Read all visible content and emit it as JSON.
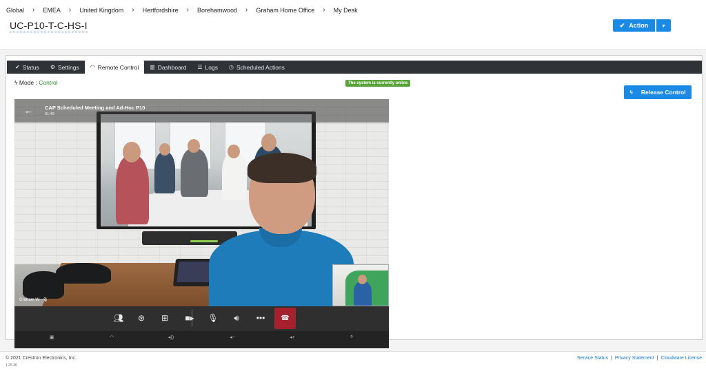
{
  "breadcrumb": [
    "Global",
    "EMEA",
    "United Kingdom",
    "Hertfordshire",
    "Borehamwood",
    "Graham Home Office",
    "My Desk"
  ],
  "page": {
    "title": "UC-P10-T-C-HS-I"
  },
  "action": {
    "label": "Action",
    "dropdown_icon": "caret-down-icon"
  },
  "tabs": [
    {
      "label": "Status",
      "icon": "check-icon"
    },
    {
      "label": "Settings",
      "icon": "gear-icon"
    },
    {
      "label": "Remote Control",
      "icon": "wifi-icon",
      "active": true
    },
    {
      "label": "Dashboard",
      "icon": "bar-chart-icon"
    },
    {
      "label": "Logs",
      "icon": "list-icon"
    },
    {
      "label": "Scheduled Actions",
      "icon": "clock-icon"
    }
  ],
  "mode": {
    "label": "Mode :",
    "value": "Control"
  },
  "status_badge": "The system is currently online",
  "release": {
    "label": "Release Control"
  },
  "device": {
    "meeting_title": "CAP Scheduled Meeting and Ad-Hoc P10",
    "meeting_time": "01:49",
    "self_name": "Graham W"
  },
  "footer": {
    "copyright": "© 2021 Crestron Electronics, Inc.",
    "version": "1.25.36",
    "links": [
      "Service Status",
      "Privacy Statement",
      "Cloudware License"
    ]
  },
  "colors": {
    "accent": "#1a8ae5",
    "online": "#5aa43c",
    "hangup": "#a5212e",
    "tabbar": "#2f3337"
  }
}
